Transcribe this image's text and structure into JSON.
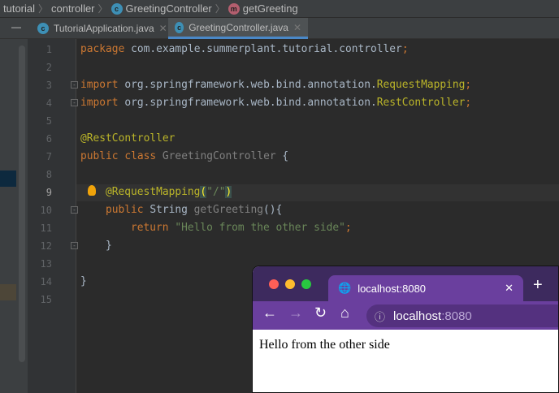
{
  "breadcrumb": [
    "tutorial",
    "controller",
    "GreetingController",
    "getGreeting"
  ],
  "tabs": [
    {
      "label": "TutorialApplication.java"
    },
    {
      "label": "GreetingController.java"
    }
  ],
  "line_numbers": [
    "1",
    "2",
    "3",
    "4",
    "5",
    "6",
    "7",
    "8",
    "9",
    "10",
    "11",
    "12",
    "13",
    "14",
    "15"
  ],
  "code": {
    "l1a": "package ",
    "l1b": "com.example.summerplant.tutorial.controller",
    "l3a": "import ",
    "l3b": "org.springframework.web.bind.annotation.",
    "l3c": "RequestMapping",
    "l4a": "import ",
    "l4b": "org.springframework.web.bind.annotation.",
    "l4c": "RestController",
    "l6": "@RestController",
    "l7a": "public class ",
    "l7b": "GreetingController ",
    "l7c": "{",
    "l9a": "@RequestMapping",
    "l9b": "(",
    "l9c": "\"/\"",
    "l9d": ")",
    "l10a": "public ",
    "l10b": "String ",
    "l10c": "getGreeting",
    "l10d": "(){",
    "l11a": "return ",
    "l11b": "\"Hello from the other side\"",
    "l11c": ";",
    "l12": "}",
    "l14": "}",
    "semi": ";"
  },
  "browser": {
    "tab_title": "localhost:8080",
    "url_host": "localhost",
    "url_port": ":8080",
    "page_text": "Hello from the other side",
    "colors": {
      "frame": "#3d2a5e",
      "toolbar": "#6a3f9e"
    }
  }
}
